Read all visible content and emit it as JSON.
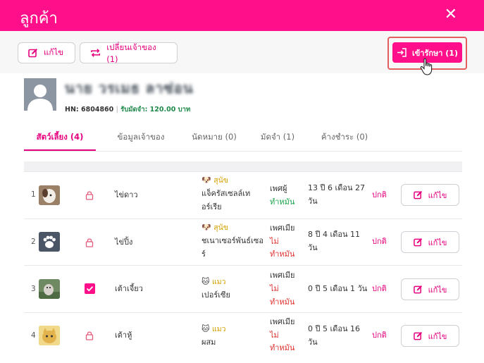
{
  "header": {
    "title": "ลูกค้า",
    "close_glyph": "✕"
  },
  "toolbar": {
    "edit_label": "แก้ไข",
    "transfer_label": "เปลี่ยนเจ้าของ (1)",
    "admit_label": "เข้ารักษา (1)"
  },
  "owner": {
    "name": "นาย วรเมธ ลาซ่อน",
    "hn": "HN: 6804860",
    "separator": "|",
    "deposit": "รับมัดจำ: 120.00 บาท"
  },
  "tabs": [
    {
      "label": "สัตว์เลี้ยง (4)"
    },
    {
      "label": "ข้อมูลเจ้าของ"
    },
    {
      "label": "นัดหมาย (0)"
    },
    {
      "label": "มัดจำ (1)"
    },
    {
      "label": "ค้างชำระ (0)"
    }
  ],
  "pets": [
    {
      "no": "1",
      "name": "ไข่ดาว",
      "species": "สุนัข",
      "breed_line1": "แจ็ครัสเซลล์เท",
      "breed_line2": "อร์เรีย",
      "sex": "เพศผู้",
      "neuter_line1": "ทำหมัน",
      "neuter_line2": "",
      "age_line1": "13 ปี 6 เดือน 27",
      "age_line2": "วัน",
      "status": "ปกติ",
      "edit_label": "แก้ไข",
      "checked": false
    },
    {
      "no": "2",
      "name": "ไข่ปิ้ง",
      "species": "สุนัข",
      "breed_line1": "ชเนาเซอร์พันธ์เซอ",
      "breed_line2": "ร์",
      "sex": "เพศเมีย",
      "neuter_line1": "ไม่",
      "neuter_line2": "ทำหมัน",
      "age_line1": "8 ปี 4 เดือน 11",
      "age_line2": "วัน",
      "status": "ปกติ",
      "edit_label": "แก้ไข",
      "checked": false
    },
    {
      "no": "3",
      "name": "เต้าเจี้ยว",
      "species": "แมว",
      "breed_line1": "เปอร์เซีย",
      "breed_line2": "",
      "sex": "เพศเมีย",
      "neuter_line1": "ไม่",
      "neuter_line2": "ทำหมัน",
      "age_line1": "0 ปี 5 เดือน 1 วัน",
      "age_line2": "",
      "status": "ปกติ",
      "edit_label": "แก้ไข",
      "checked": true
    },
    {
      "no": "4",
      "name": "เต้าหู้",
      "species": "แมว",
      "breed_line1": "ผสม",
      "breed_line2": "",
      "sex": "เพศเมีย",
      "neuter_line1": "ไม่",
      "neuter_line2": "ทำหมัน",
      "age_line1": "0 ปี 5 เดือน 16",
      "age_line2": "วัน",
      "status": "ปกติ",
      "edit_label": "แก้ไข",
      "checked": false
    }
  ],
  "colors": {
    "brand": "#ff0f8a",
    "accent_text": "#e6007e",
    "deposit_green": "#1e8a4a",
    "neutered_green": "#17a34a",
    "not_neutered_red": "#e0302e",
    "species_gold": "#d4a000"
  }
}
